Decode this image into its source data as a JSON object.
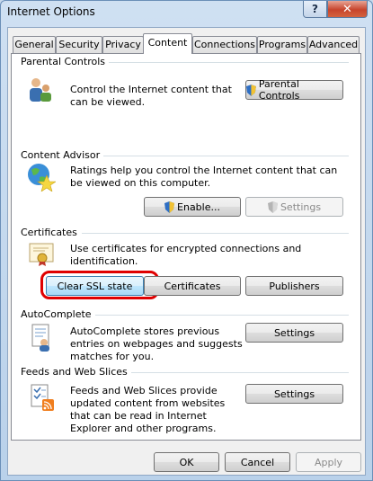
{
  "window": {
    "title": "Internet Options",
    "help_glyph": "?",
    "close_glyph": "✕"
  },
  "tabs": [
    {
      "label": "General"
    },
    {
      "label": "Security"
    },
    {
      "label": "Privacy"
    },
    {
      "label": "Content",
      "active": true
    },
    {
      "label": "Connections"
    },
    {
      "label": "Programs"
    },
    {
      "label": "Advanced"
    }
  ],
  "parental": {
    "heading": "Parental Controls",
    "description": "Control the Internet content that can be viewed.",
    "button": "Parental Controls"
  },
  "advisor": {
    "heading": "Content Advisor",
    "description": "Ratings help you control the Internet content that can be viewed on this computer.",
    "enable_button": "Enable...",
    "settings_button": "Settings"
  },
  "certificates": {
    "heading": "Certificates",
    "description": "Use certificates for encrypted connections and identification.",
    "clear_ssl_button": "Clear SSL state",
    "certificates_button": "Certificates",
    "publishers_button": "Publishers"
  },
  "autocomplete": {
    "heading": "AutoComplete",
    "description": "AutoComplete stores previous entries on webpages and suggests matches for you.",
    "settings_button": "Settings"
  },
  "feeds": {
    "heading": "Feeds and Web Slices",
    "description": "Feeds and Web Slices provide updated content from websites that can be read in Internet Explorer and other programs.",
    "settings_button": "Settings"
  },
  "footer": {
    "ok": "OK",
    "cancel": "Cancel",
    "apply": "Apply"
  },
  "colors": {
    "highlight": "#e00000",
    "focus_border": "#3c7fb1",
    "close_button": "#c7442c"
  }
}
